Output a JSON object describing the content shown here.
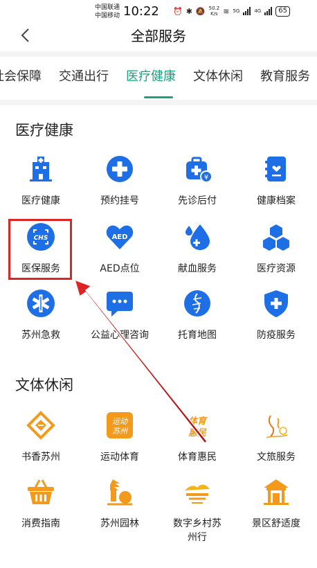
{
  "status_bar": {
    "carrier1": "中国联通",
    "carrier2": "中国移动",
    "time": "10:22",
    "speed_value": "50.2",
    "speed_unit": "K/s",
    "net1": "5G",
    "net2": "4G",
    "battery": "65"
  },
  "header": {
    "title": "全部服务"
  },
  "tabs": [
    "社会保障",
    "交通出行",
    "医疗健康",
    "文体休闲",
    "教育服务"
  ],
  "medical": {
    "title": "医疗健康",
    "items": [
      {
        "label": "医疗健康",
        "icon": "hospital-icon"
      },
      {
        "label": "预约挂号",
        "icon": "medical-cross-icon"
      },
      {
        "label": "先诊后付",
        "icon": "medkit-payment-icon"
      },
      {
        "label": "健康档案",
        "icon": "health-record-icon"
      },
      {
        "label": "医保服务",
        "icon": "chs-insurance-icon"
      },
      {
        "label": "AED点位",
        "icon": "aed-heart-icon"
      },
      {
        "label": "献血服务",
        "icon": "blood-drop-icon"
      },
      {
        "label": "医疗资源",
        "icon": "cubes-icon"
      },
      {
        "label": "苏州急救",
        "icon": "star-of-life-icon"
      },
      {
        "label": "公益心理咨询",
        "icon": "chat-bubble-icon"
      },
      {
        "label": "托育地图",
        "icon": "childcare-map-icon"
      },
      {
        "label": "防疫服务",
        "icon": "shield-cross-icon"
      }
    ]
  },
  "culture": {
    "title": "文体休闲",
    "items": [
      {
        "label": "书香苏州",
        "icon": "book-fragrance-icon"
      },
      {
        "label": "运动体育",
        "icon": "sports-badge-icon",
        "badge": "运动\n苏州"
      },
      {
        "label": "体育惠民",
        "icon": "sports-benefit-icon",
        "badge": "体育惠民"
      },
      {
        "label": "文旅服务",
        "icon": "culture-travel-icon"
      },
      {
        "label": "消费指南",
        "icon": "shopping-basket-icon"
      },
      {
        "label": "苏州园林",
        "icon": "garden-pagoda-icon"
      },
      {
        "label": "数字乡村苏州行",
        "icon": "village-landscape-icon"
      },
      {
        "label": "景区舒适度",
        "icon": "pavilion-icon"
      }
    ]
  },
  "colors": {
    "accent": "#17a37f",
    "medical_blue": "#1e6fe6",
    "culture_orange": "#f39a1d",
    "annotation_red": "#e02424"
  }
}
